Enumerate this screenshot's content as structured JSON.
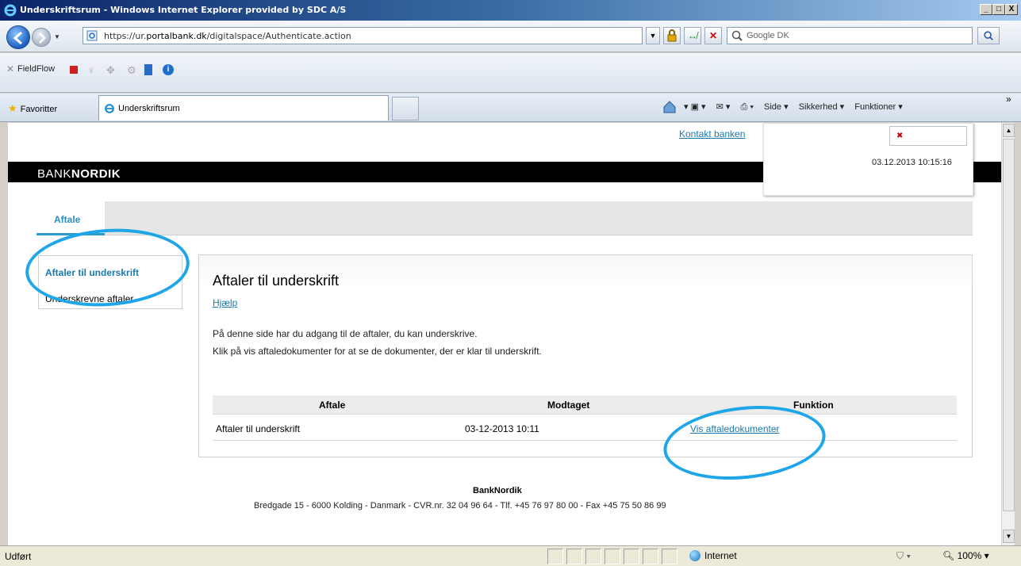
{
  "window": {
    "title": "Underskriftsrum - Windows Internet Explorer provided by SDC A/S",
    "minimize": "_",
    "maximize": "□",
    "close": "X"
  },
  "address_bar": {
    "url_prefix": "https://ur.",
    "url_domain": "portalbank.dk",
    "url_suffix": "/digitalspace/Authenticate.action",
    "search_placeholder": "Google DK"
  },
  "toolbar": {
    "fieldflow_label": "FieldFlow"
  },
  "tab_row": {
    "favorites_label": "Favoritter",
    "tab_title": "Underskriftsrum",
    "commands": [
      "Side ▾",
      "Sikkerhed ▾",
      "Funktioner ▾"
    ]
  },
  "page": {
    "contact_link": "Kontakt banken",
    "timestamp": "03.12.2013 10:15:16",
    "logo_regular": "BANK",
    "logo_bold": "NORDIK",
    "main_tab": "Aftale",
    "side_menu": [
      "Aftaler til underskrift",
      "Underskrevne aftaler"
    ],
    "heading": "Aftaler til underskrift",
    "help_link": "Hjælp",
    "intro_1": "På denne side har du adgang til de aftaler, du kan underskrive.",
    "intro_2": "Klik på vis aftaledokumenter for at se de dokumenter, der er klar til underskrift.",
    "table": {
      "headers": [
        "Aftale",
        "Modtaget",
        "Funktion"
      ],
      "rows": [
        {
          "aftale": "Aftaler til underskrift",
          "modtaget": "03-12-2013 10:11",
          "funktion": "Vis aftaledokumenter"
        }
      ]
    },
    "footer_name": "BankNordik",
    "footer_address": "Bredgade 15 - 6000 Kolding - Danmark - CVR.nr. 32 04 96 64 - Tlf. +45 76 97 80 00 - Fax +45 75 50 86 99"
  },
  "status_bar": {
    "status": "Udført",
    "zone": "Internet",
    "zoom": "100%"
  }
}
